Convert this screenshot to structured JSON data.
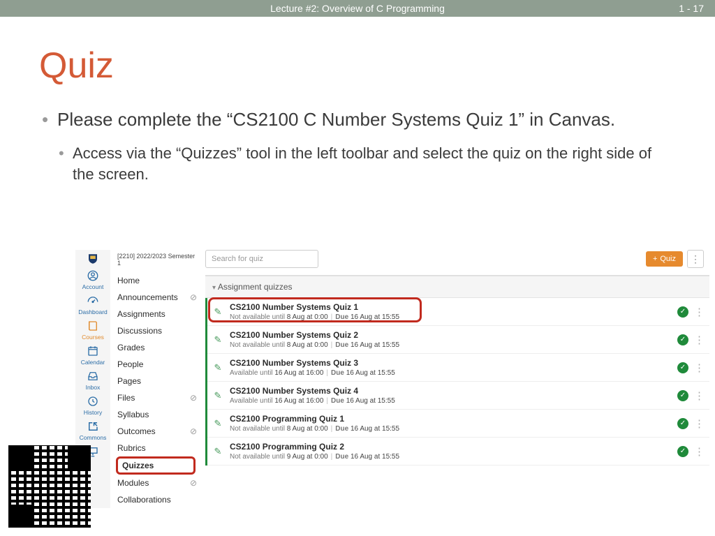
{
  "header": {
    "title": "Lecture #2: Overview of C Programming",
    "page": "1 - 17"
  },
  "title": "Quiz",
  "b1": "Please complete the “CS2100 C Number Systems Quiz 1” in Canvas.",
  "b2": "Access via the “Quizzes” tool in the left toolbar and select the quiz on  the right side of the screen.",
  "rail": {
    "account": "Account",
    "dashboard": "Dashboard",
    "courses": "Courses",
    "calendar": "Calendar",
    "inbox": "Inbox",
    "history": "History",
    "commons": "Commons"
  },
  "course": "[2210] 2022/2023 Semester 1",
  "nav": {
    "home": "Home",
    "announcements": "Announcements",
    "assignments": "Assignments",
    "discussions": "Discussions",
    "grades": "Grades",
    "people": "People",
    "pages": "Pages",
    "files": "Files",
    "syllabus": "Syllabus",
    "outcomes": "Outcomes",
    "rubrics": "Rubrics",
    "quizzes": "Quizzes",
    "modules": "Modules",
    "collaborations": "Collaborations"
  },
  "search_placeholder": "Search for quiz",
  "quiz_btn": "Quiz",
  "section": "Assignment quizzes",
  "rows": [
    {
      "title": "CS2100 Number Systems Quiz 1",
      "avail_lbl": "Not available until",
      "avail_val": "8 Aug at 0:00",
      "due_lbl": "Due",
      "due_val": "16 Aug at 15:55"
    },
    {
      "title": "CS2100 Number Systems Quiz 2",
      "avail_lbl": "Not available until",
      "avail_val": "8 Aug at 0:00",
      "due_lbl": "Due",
      "due_val": "16 Aug at 15:55"
    },
    {
      "title": "CS2100 Number Systems Quiz 3",
      "avail_lbl": "Available until",
      "avail_val": "16 Aug at 16:00",
      "due_lbl": "Due",
      "due_val": "16 Aug at 15:55"
    },
    {
      "title": "CS2100 Number Systems Quiz 4",
      "avail_lbl": "Available until",
      "avail_val": "16 Aug at 16:00",
      "due_lbl": "Due",
      "due_val": "16 Aug at 15:55"
    },
    {
      "title": "CS2100 Programming Quiz 1",
      "avail_lbl": "Not available until",
      "avail_val": "8 Aug at 0:00",
      "due_lbl": "Due",
      "due_val": "16 Aug at 15:55"
    },
    {
      "title": "CS2100 Programming Quiz 2",
      "avail_lbl": "Not available until",
      "avail_val": "9 Aug at 0:00",
      "due_lbl": "Due",
      "due_val": "16 Aug at 15:55"
    }
  ]
}
